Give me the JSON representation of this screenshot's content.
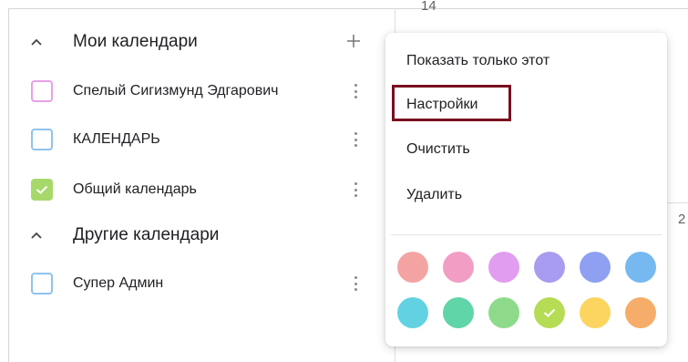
{
  "calendar_grid": {
    "day_number_top": "14",
    "day_number_right": "2"
  },
  "sidebar": {
    "my_calendars": {
      "title": "Мои календари",
      "items": [
        {
          "label": "Спелый Сигизмунд Эдгарович",
          "checked": false,
          "color": "#e8a0e8"
        },
        {
          "label": "КАЛЕНДАРЬ",
          "checked": false,
          "color": "#8fc3ee"
        },
        {
          "label": "Общий календарь",
          "checked": true,
          "color": "#a6d96a"
        }
      ]
    },
    "other_calendars": {
      "title": "Другие календари",
      "items": [
        {
          "label": "Супер Админ",
          "checked": false,
          "color": "#8fc3ee"
        }
      ]
    }
  },
  "context_menu": {
    "items": [
      {
        "label": "Показать только этот"
      },
      {
        "label": "Настройки",
        "highlighted": true
      },
      {
        "label": "Очистить"
      },
      {
        "label": "Удалить"
      }
    ],
    "highlight_color": "#7a1020",
    "swatches": [
      {
        "color": "#f4a3a3",
        "selected": false
      },
      {
        "color": "#f19dc4",
        "selected": false
      },
      {
        "color": "#e19df0",
        "selected": false
      },
      {
        "color": "#a89cf0",
        "selected": false
      },
      {
        "color": "#8fa0f2",
        "selected": false
      },
      {
        "color": "#76b8f0",
        "selected": false
      },
      {
        "color": "#62d2e2",
        "selected": false
      },
      {
        "color": "#5fd5a8",
        "selected": false
      },
      {
        "color": "#8ddb8a",
        "selected": false
      },
      {
        "color": "#b6dc55",
        "selected": true
      },
      {
        "color": "#fcd560",
        "selected": false
      },
      {
        "color": "#f6ad6a",
        "selected": false
      }
    ]
  }
}
